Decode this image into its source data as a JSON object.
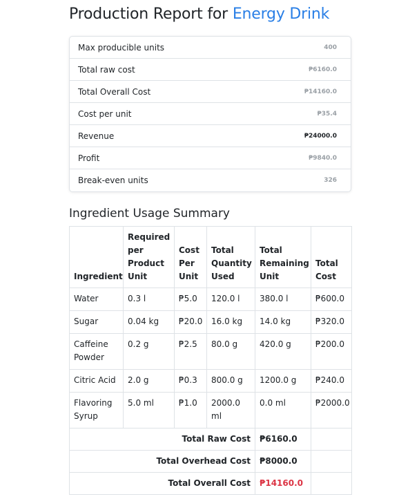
{
  "title": {
    "prefix": "Production Report for ",
    "product": "Energy Drink"
  },
  "summary": [
    {
      "label": "Max producible units",
      "value": "400",
      "emphasis": false
    },
    {
      "label": "Total raw cost",
      "value": "₱6160.0",
      "emphasis": false
    },
    {
      "label": "Total Overall Cost",
      "value": "₱14160.0",
      "emphasis": false
    },
    {
      "label": "Cost per unit",
      "value": "₱35.4",
      "emphasis": false
    },
    {
      "label": "Revenue",
      "value": "₱24000.0",
      "emphasis": true
    },
    {
      "label": "Profit",
      "value": "₱9840.0",
      "emphasis": false
    },
    {
      "label": "Break-even units",
      "value": "326",
      "emphasis": false
    }
  ],
  "ingredients": {
    "heading": "Ingredient Usage Summary",
    "columns": [
      "Ingredient",
      "Required per Product Unit",
      "Cost Per Unit",
      "Total Quantity Used",
      "Total Remaining Unit",
      "Total Cost"
    ],
    "rows": [
      [
        "Water",
        "0.3 l",
        "₱5.0",
        "120.0 l",
        "380.0 l",
        "₱600.0"
      ],
      [
        "Sugar",
        "0.04 kg",
        "₱20.0",
        "16.0 kg",
        "14.0 kg",
        "₱320.0"
      ],
      [
        "Caffeine Powder",
        "0.2 g",
        "₱2.5",
        "80.0 g",
        "420.0 g",
        "₱200.0"
      ],
      [
        "Citric Acid",
        "2.0 g",
        "₱0.3",
        "800.0 g",
        "1200.0 g",
        "₱240.0"
      ],
      [
        "Flavoring Syrup",
        "5.0 ml",
        "₱1.0",
        "2000.0 ml",
        "0.0 ml",
        "₱2000.0"
      ]
    ],
    "totals": [
      {
        "label": "Total Raw Cost",
        "value": "₱6160.0"
      },
      {
        "label": "Total Overhead Cost",
        "value": "₱8000.0"
      },
      {
        "label": "Total Overall Cost",
        "value": "₱14160.0"
      }
    ]
  },
  "colors": {
    "accent": "#2a7fe6",
    "muted": "#9aa0a6",
    "danger": "#dc3545"
  }
}
